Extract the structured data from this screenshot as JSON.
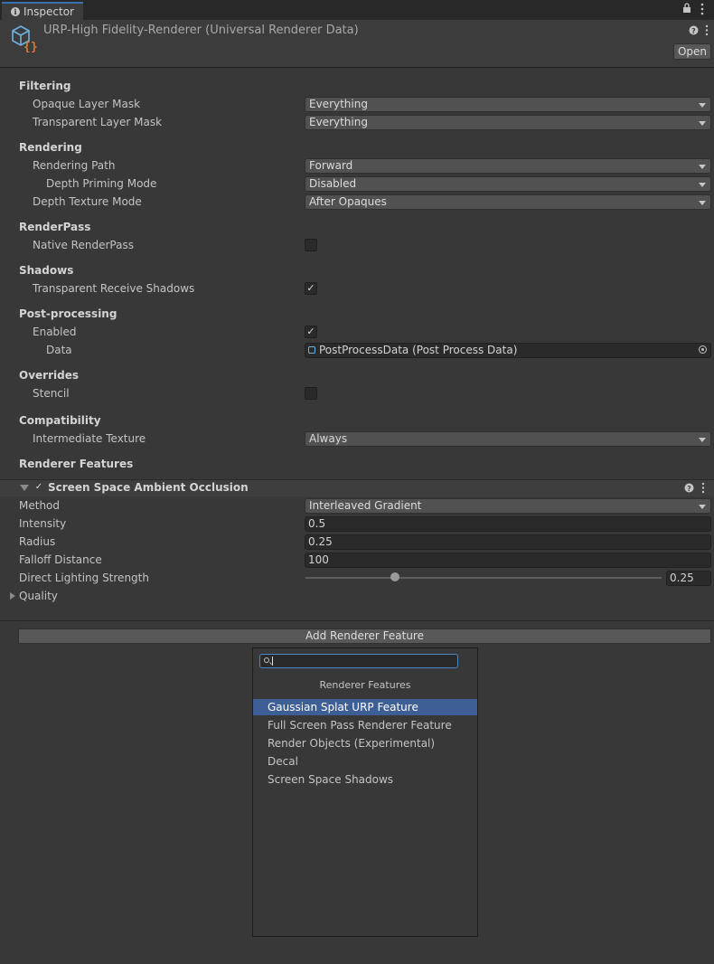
{
  "tab": {
    "label": "Inspector"
  },
  "header": {
    "title": "URP-High Fidelity-Renderer (Universal Renderer Data)",
    "open_label": "Open"
  },
  "sections": {
    "filtering": "Filtering",
    "rendering": "Rendering",
    "renderpass": "RenderPass",
    "shadows": "Shadows",
    "postprocessing": "Post-processing",
    "overrides": "Overrides",
    "compatibility": "Compatibility",
    "renderer_features": "Renderer Features"
  },
  "fields": {
    "opaque_layer_mask": {
      "label": "Opaque Layer Mask",
      "value": "Everything"
    },
    "transparent_layer_mask": {
      "label": "Transparent Layer Mask",
      "value": "Everything"
    },
    "rendering_path": {
      "label": "Rendering Path",
      "value": "Forward"
    },
    "depth_priming_mode": {
      "label": "Depth Priming Mode",
      "value": "Disabled"
    },
    "depth_texture_mode": {
      "label": "Depth Texture Mode",
      "value": "After Opaques"
    },
    "native_renderpass": {
      "label": "Native RenderPass",
      "checked": false
    },
    "transparent_receive_shadows": {
      "label": "Transparent Receive Shadows",
      "checked": true,
      "mark": "✓"
    },
    "pp_enabled": {
      "label": "Enabled",
      "checked": true,
      "mark": "✓"
    },
    "pp_data": {
      "label": "Data",
      "value": "PostProcessData (Post Process Data)"
    },
    "stencil": {
      "label": "Stencil",
      "checked": false
    },
    "intermediate_texture": {
      "label": "Intermediate Texture",
      "value": "Always"
    }
  },
  "feature": {
    "name": "Screen Space Ambient Occlusion",
    "enabled_mark": "✓",
    "method": {
      "label": "Method",
      "value": "Interleaved Gradient"
    },
    "intensity": {
      "label": "Intensity",
      "value": "0.5"
    },
    "radius": {
      "label": "Radius",
      "value": "0.25"
    },
    "falloff_distance": {
      "label": "Falloff Distance",
      "value": "100"
    },
    "direct_lighting_strength": {
      "label": "Direct Lighting Strength",
      "value": "0.25",
      "slider_fraction": 0.25
    },
    "quality": {
      "label": "Quality"
    }
  },
  "add_feature_label": "Add Renderer Feature",
  "popup": {
    "search_value": "",
    "title": "Renderer Features",
    "items": [
      "Gaussian Splat URP Feature",
      "Full Screen Pass Renderer Feature",
      "Render Objects (Experimental)",
      "Decal",
      "Screen Space Shadows"
    ],
    "selected_index": 0
  },
  "colors": {
    "accent": "#3e5f96",
    "background": "#383838",
    "focus_border": "#4e84c4",
    "icon_blue": "#6fb3e0",
    "icon_orange": "#e0743a"
  }
}
